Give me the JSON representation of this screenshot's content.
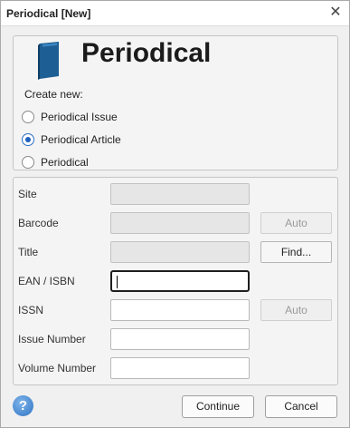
{
  "window": {
    "title": "Periodical [New]",
    "close_glyph": "✕"
  },
  "header": {
    "icon": "book-icon",
    "title": "Periodical",
    "create_new_label": "Create new:",
    "options": [
      {
        "label": "Periodical Issue",
        "checked": false
      },
      {
        "label": "Periodical Article",
        "checked": true
      },
      {
        "label": "Periodical",
        "checked": false
      }
    ]
  },
  "form": {
    "site_label": "Site",
    "site_value": "",
    "barcode_label": "Barcode",
    "barcode_value": "",
    "barcode_auto_label": "Auto",
    "title_label": "Title",
    "title_value": "",
    "find_label": "Find...",
    "ean_label": "EAN / ISBN",
    "ean_value": "",
    "issn_label": "ISSN",
    "issn_value": "",
    "issn_auto_label": "Auto",
    "issue_number_label": "Issue Number",
    "issue_number_value": "",
    "volume_number_label": "Volume Number",
    "volume_number_value": ""
  },
  "footer": {
    "help_glyph": "?",
    "continue_label": "Continue",
    "cancel_label": "Cancel"
  },
  "colors": {
    "accent": "#1f5fbf",
    "help_icon": "#2f74c4"
  }
}
